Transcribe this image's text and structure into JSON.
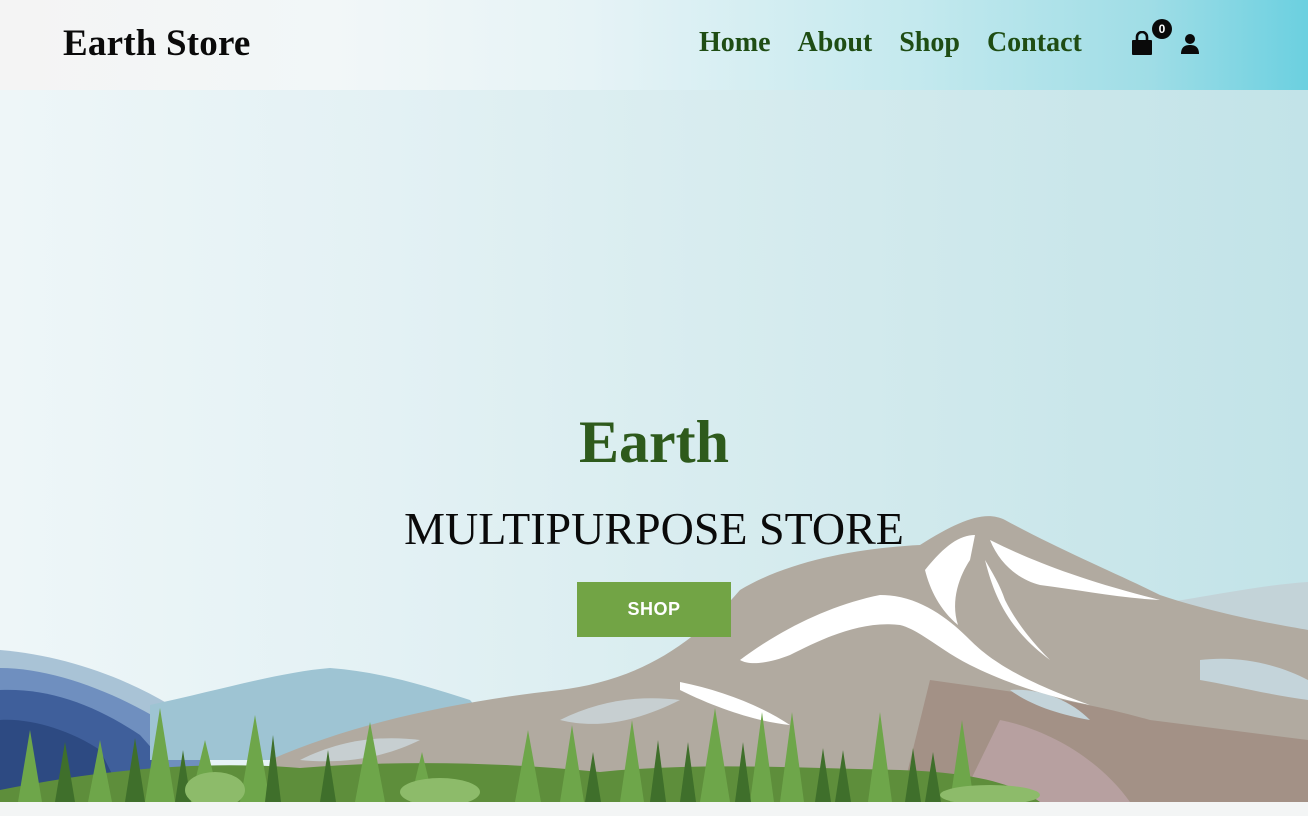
{
  "header": {
    "brand": "Earth Store",
    "nav": [
      {
        "label": "Home"
      },
      {
        "label": "About"
      },
      {
        "label": "Shop"
      },
      {
        "label": "Contact"
      }
    ],
    "cart_count": "0",
    "cart_icon": "shopping-bag-icon",
    "user_icon": "user-icon"
  },
  "hero": {
    "title": "Earth",
    "subtitle": "MULTIPURPOSE STORE",
    "button_label": "SHOP"
  },
  "colors": {
    "brand_green": "#2e5a1c",
    "nav_green": "#1f4d14",
    "button_green": "#72a445",
    "header_accent": "#6bd0e0"
  }
}
